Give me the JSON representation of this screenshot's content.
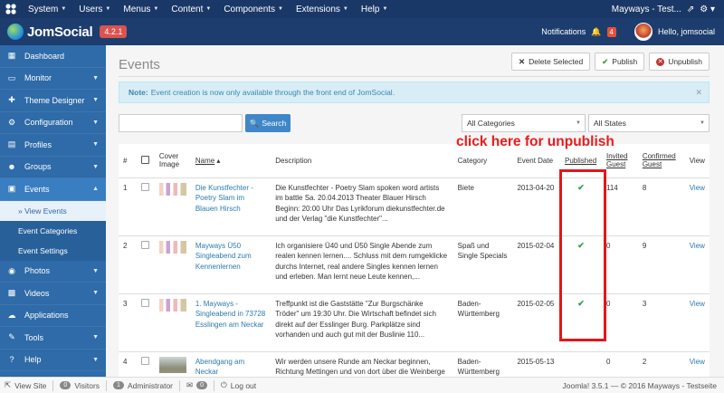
{
  "topbar": {
    "menu": [
      {
        "label": "System"
      },
      {
        "label": "Users"
      },
      {
        "label": "Menus"
      },
      {
        "label": "Content"
      },
      {
        "label": "Components"
      },
      {
        "label": "Extensions"
      },
      {
        "label": "Help"
      }
    ],
    "site_name": "Mayways - Test...",
    "icon_joomla": "joomla-logo-icon",
    "icon_gear": "gear-icon"
  },
  "header": {
    "logo_text": "JomSocial",
    "version": "4.2.1",
    "notifications_label": "Notifications",
    "notifications_count": "4",
    "greeting": "Hello, jomsocial"
  },
  "sidebar": {
    "items": [
      {
        "label": "Dashboard",
        "icon": "dashboard-icon"
      },
      {
        "label": "Monitor",
        "icon": "monitor-icon"
      },
      {
        "label": "Theme Designer",
        "icon": "puzzle-icon"
      },
      {
        "label": "Configuration",
        "icon": "cogs-icon"
      },
      {
        "label": "Profiles",
        "icon": "profile-icon"
      },
      {
        "label": "Groups",
        "icon": "groups-icon"
      },
      {
        "label": "Events",
        "icon": "calendar-icon"
      },
      {
        "label": "Photos",
        "icon": "camera-icon"
      },
      {
        "label": "Videos",
        "icon": "film-icon"
      },
      {
        "label": "Applications",
        "icon": "cloud-icon"
      },
      {
        "label": "Tools",
        "icon": "wrench-icon"
      },
      {
        "label": "Help",
        "icon": "help-icon"
      }
    ],
    "events_sub": [
      {
        "label": "» View Events"
      },
      {
        "label": "Event Categories"
      },
      {
        "label": "Event Settings"
      }
    ]
  },
  "page": {
    "title": "Events",
    "delete_label": "Delete Selected",
    "publish_label": "Publish",
    "unpublish_label": "Unpublish",
    "note_bold": "Note:",
    "note_text": "Event creation is now only available through the front end of JomSocial.",
    "search_placeholder": "",
    "search_button": "Search",
    "filter_category": "All Categories",
    "filter_state": "All States",
    "annotation": "click here for unpublish"
  },
  "table": {
    "headers": {
      "num": "#",
      "cover1": "Cover",
      "cover2": "Image",
      "name": "Name",
      "description": "Description",
      "category": "Category",
      "date": "Event Date",
      "published": "Published",
      "invited1": "Invited",
      "invited2": "Guest",
      "confirmed1": "Confirmed",
      "confirmed2": "Guest",
      "view": "View"
    },
    "rows": [
      {
        "num": "1",
        "name": "Die Kunstfechter - Poetry Slam im Blauen Hirsch",
        "description": "Die Kunstfechter - Poetry Slam spoken word artists im battle Sa. 20.04.2013 Theater Blauer Hirsch Beginn: 20:00 Uhr Das Lyrikforum diekunstfechter.de und der Verlag \"die Kunstfechter\"...",
        "category": "Biete",
        "date": "2013-04-20",
        "published": "✔",
        "invited": "114",
        "confirmed": "8",
        "view": "View"
      },
      {
        "num": "2",
        "name": "Mayways Ü50 Singleabend zum Kennenlernen",
        "description": "Ich organisiere Ü40 und Ü50 Single Abende zum realen kennen lernen.... Schluss mit dem rumgeklicke durchs Internet, real andere Singles kennen lernen und erleben. Man lernt neue Leute kennen,...",
        "category": "Spaß und Single Specials",
        "date": "2015-02-04",
        "published": "✔",
        "invited": "0",
        "confirmed": "9",
        "view": "View"
      },
      {
        "num": "3",
        "name": "1. Mayways - Singleabend in 73728 Esslingen am Neckar",
        "description": "Treffpunkt ist die Gaststätte \"Zur Burgschänke Tröder\" um 19:30 Uhr. Die Wirtschaft befindet sich direkt auf der Esslinger Burg. Parkplätze sind vorhanden und auch gut mit der Buslinie 110...",
        "category": "Baden-Württemberg",
        "date": "2015-02-05",
        "published": "✔",
        "invited": "0",
        "confirmed": "3",
        "view": "View"
      },
      {
        "num": "4",
        "name": "Abendgang am Neckar",
        "description": "Wir werden unsere Runde am Neckar beginnen, Richtung Mettingen und von dort über die Weinberge",
        "category": "Baden-Württemberg",
        "date": "2015-05-13",
        "published": "",
        "invited": "0",
        "confirmed": "2",
        "view": "View"
      }
    ]
  },
  "footer": {
    "view_site": "View Site",
    "visitors_count": "0",
    "visitors_label": "Visitors",
    "admin_count": "1",
    "admin_label": "Administrator",
    "messages_count": "0",
    "logout": "Log out",
    "right": "Joomla! 3.5.1 — © 2016 Mayways - Testseite"
  }
}
